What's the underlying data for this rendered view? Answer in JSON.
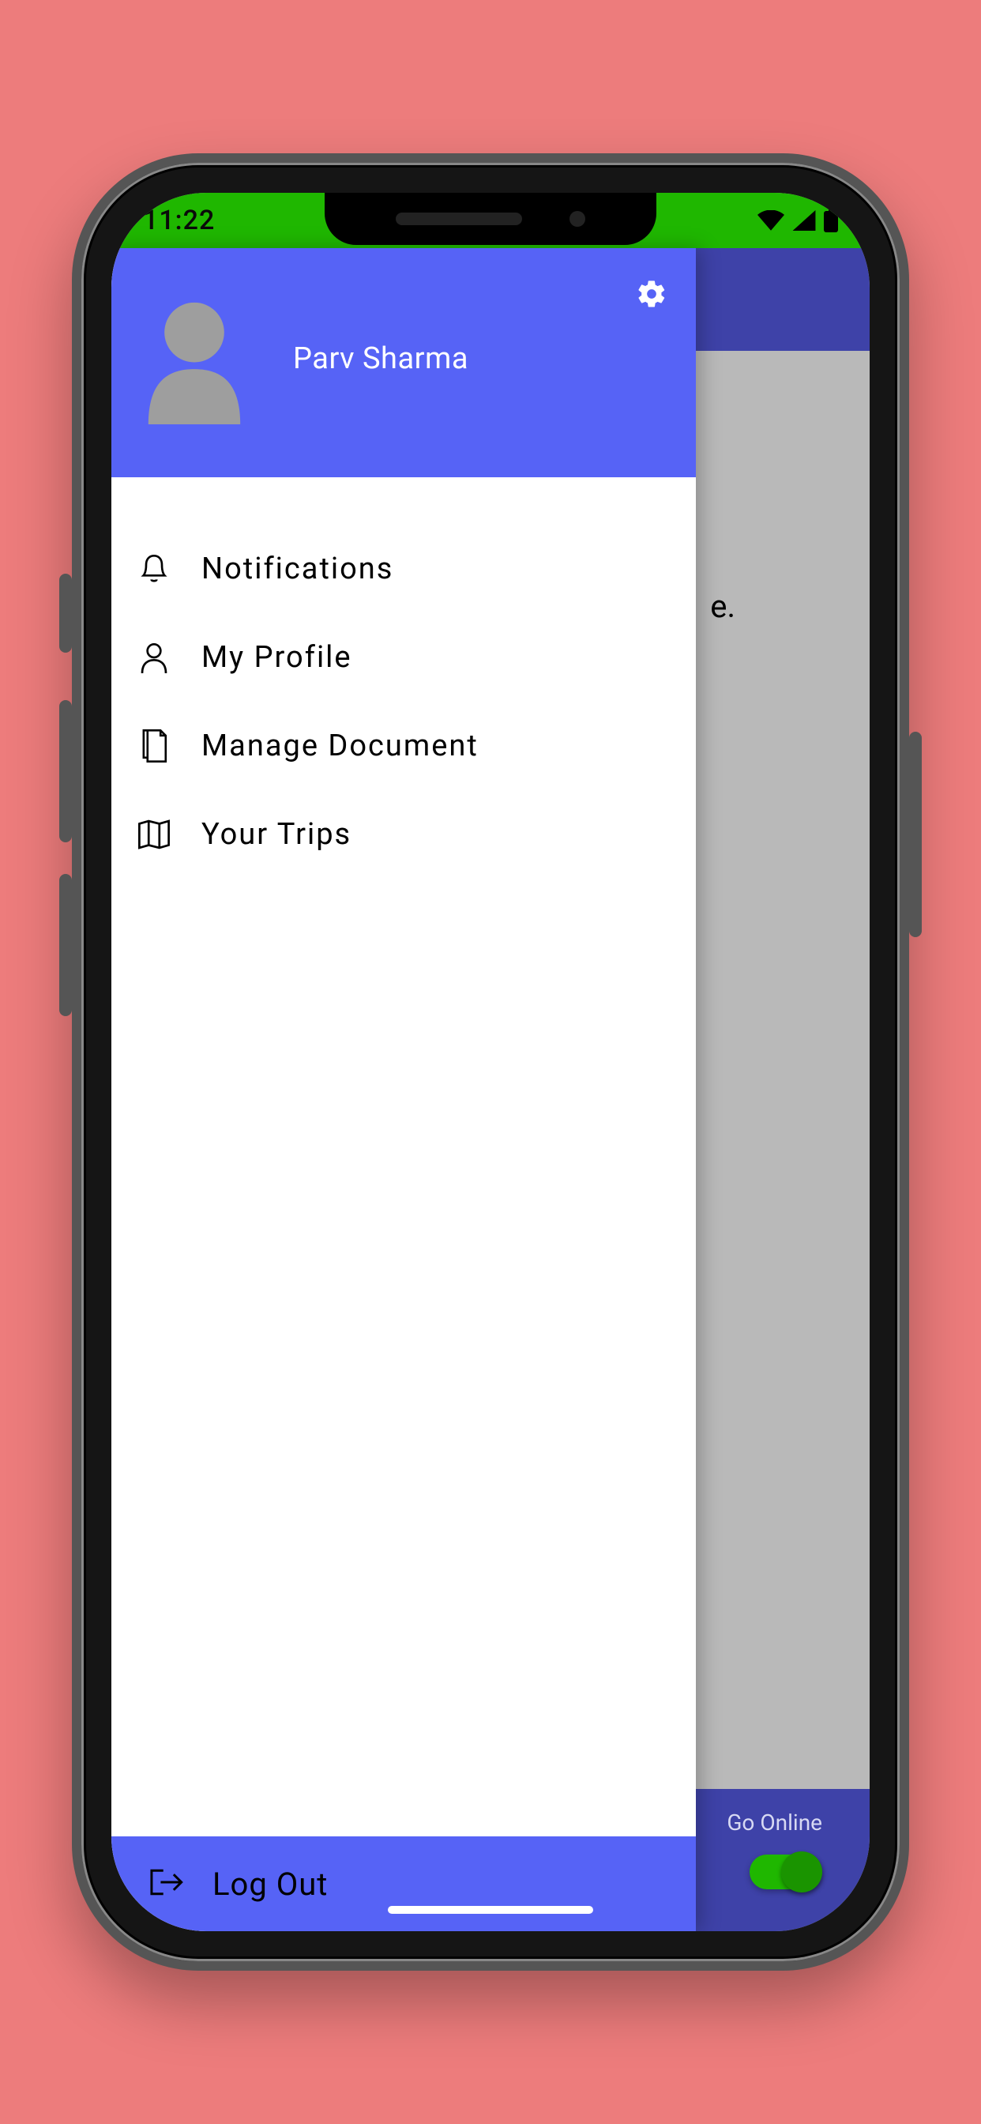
{
  "status": {
    "time": "11:22",
    "signal_icon": "signal-icon",
    "wifi_icon": "wifi-icon",
    "battery_icon": "battery-icon"
  },
  "drawer": {
    "user_name": "Parv Sharma",
    "settings_icon": "gear-icon",
    "avatar_icon": "avatar-icon",
    "menu": [
      {
        "icon": "bell-icon",
        "label": "Notifications",
        "name": "menu-notifications"
      },
      {
        "icon": "person-icon",
        "label": "My Profile",
        "name": "menu-my-profile"
      },
      {
        "icon": "document-icon",
        "label": "Manage Document",
        "name": "menu-manage-document"
      },
      {
        "icon": "map-icon",
        "label": "Your Trips",
        "name": "menu-your-trips"
      }
    ],
    "logout": {
      "icon": "logout-icon",
      "label": "Log Out"
    }
  },
  "background": {
    "partial_text": "e.",
    "footer": {
      "label": "Go Online",
      "toggle_state": true
    }
  },
  "colors": {
    "page_bg": "#ed7c7c",
    "status_bg": "#1fb700",
    "drawer_accent": "#5663f6",
    "app_accent": "#3e42a8",
    "toggle_on": "#1fb700"
  }
}
